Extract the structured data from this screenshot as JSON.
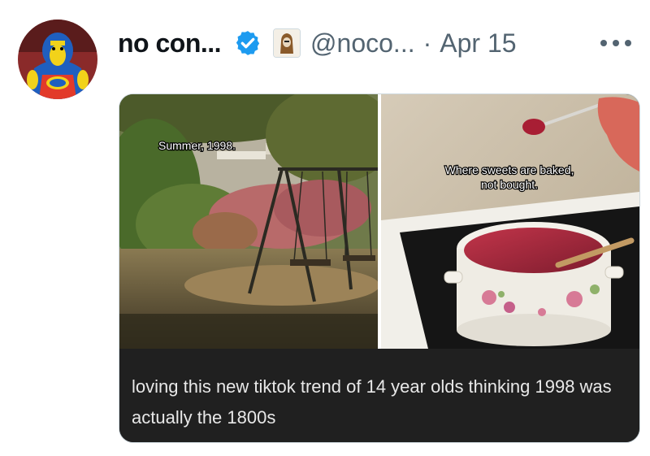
{
  "tweet": {
    "display_name": "no con...",
    "handle": "@noco...",
    "separator": "·",
    "date": "Apr 15",
    "verified_color": "#1d9bf0"
  },
  "media": {
    "left_photo_caption": "Summer, 1998.",
    "right_photo_caption_line1": "Where sweets are baked,",
    "right_photo_caption_line2": "not bought.",
    "caption": "loving this new tiktok trend of 14 year olds thinking 1998 was actually the 1800s"
  }
}
